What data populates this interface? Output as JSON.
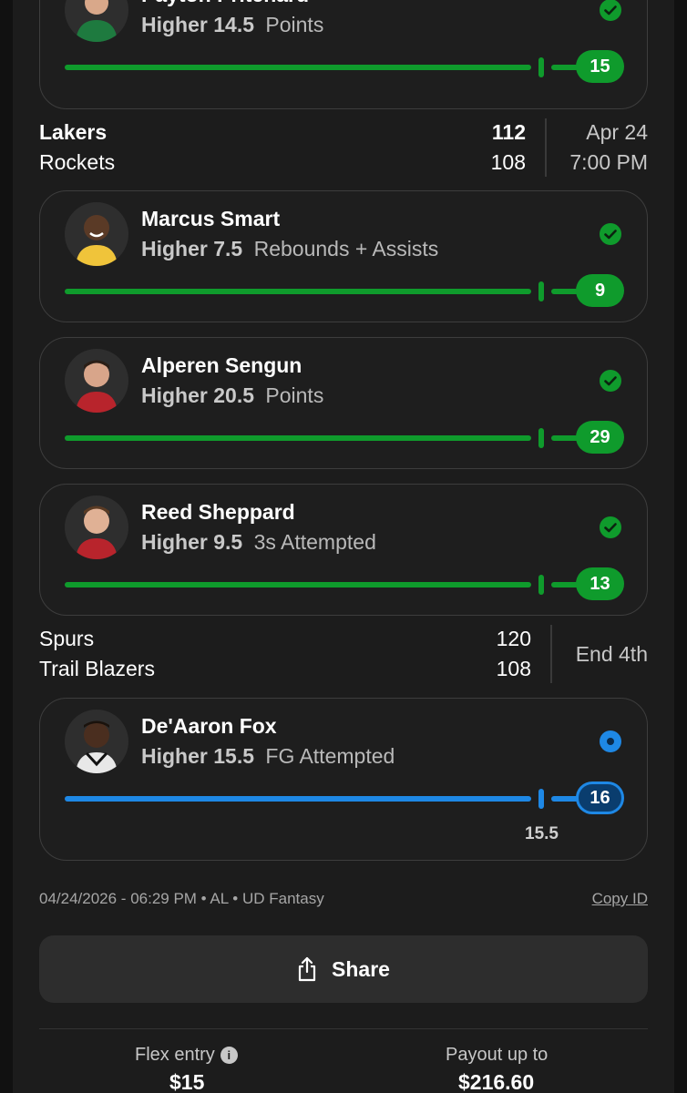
{
  "colors": {
    "hit": "#0f9b2c",
    "live": "#1e88e5"
  },
  "picks": [
    {
      "player": "Payton Pritchard",
      "direction": "Higher",
      "line": "14.5",
      "stat": "Points",
      "result": "15",
      "status": "hit",
      "status_icon": "checkmark-icon"
    },
    {
      "player": "Marcus Smart",
      "direction": "Higher",
      "line": "7.5",
      "stat": "Rebounds + Assists",
      "result": "9",
      "status": "hit",
      "status_icon": "checkmark-icon"
    },
    {
      "player": "Alperen Sengun",
      "direction": "Higher",
      "line": "20.5",
      "stat": "Points",
      "result": "29",
      "status": "hit",
      "status_icon": "checkmark-icon"
    },
    {
      "player": "Reed Sheppard",
      "direction": "Higher",
      "line": "9.5",
      "stat": "3s Attempted",
      "result": "13",
      "status": "hit",
      "status_icon": "checkmark-icon"
    },
    {
      "player": "De'Aaron Fox",
      "direction": "Higher",
      "line": "15.5",
      "stat": "FG Attempted",
      "result": "16",
      "status": "live",
      "status_icon": "live-dot-icon",
      "line_marker": "15.5"
    }
  ],
  "games": [
    {
      "team1": "Lakers",
      "score1": "112",
      "team2": "Rockets",
      "score2": "108",
      "info1": "Apr 24",
      "info2": "7:00 PM"
    },
    {
      "team1": "Spurs",
      "score1": "120",
      "team2": "Trail Blazers",
      "score2": "108",
      "info1": "End 4th"
    }
  ],
  "meta": {
    "text": "04/24/2026 - 06:29 PM • AL • UD Fantasy",
    "copy_id": "Copy ID"
  },
  "share": {
    "label": "Share",
    "icon": "share-icon"
  },
  "footer": {
    "entry_label": "Flex entry",
    "entry_value": "$15",
    "entry_icon": "info-icon",
    "payout_label": "Payout up to",
    "payout_value": "$216.60"
  }
}
